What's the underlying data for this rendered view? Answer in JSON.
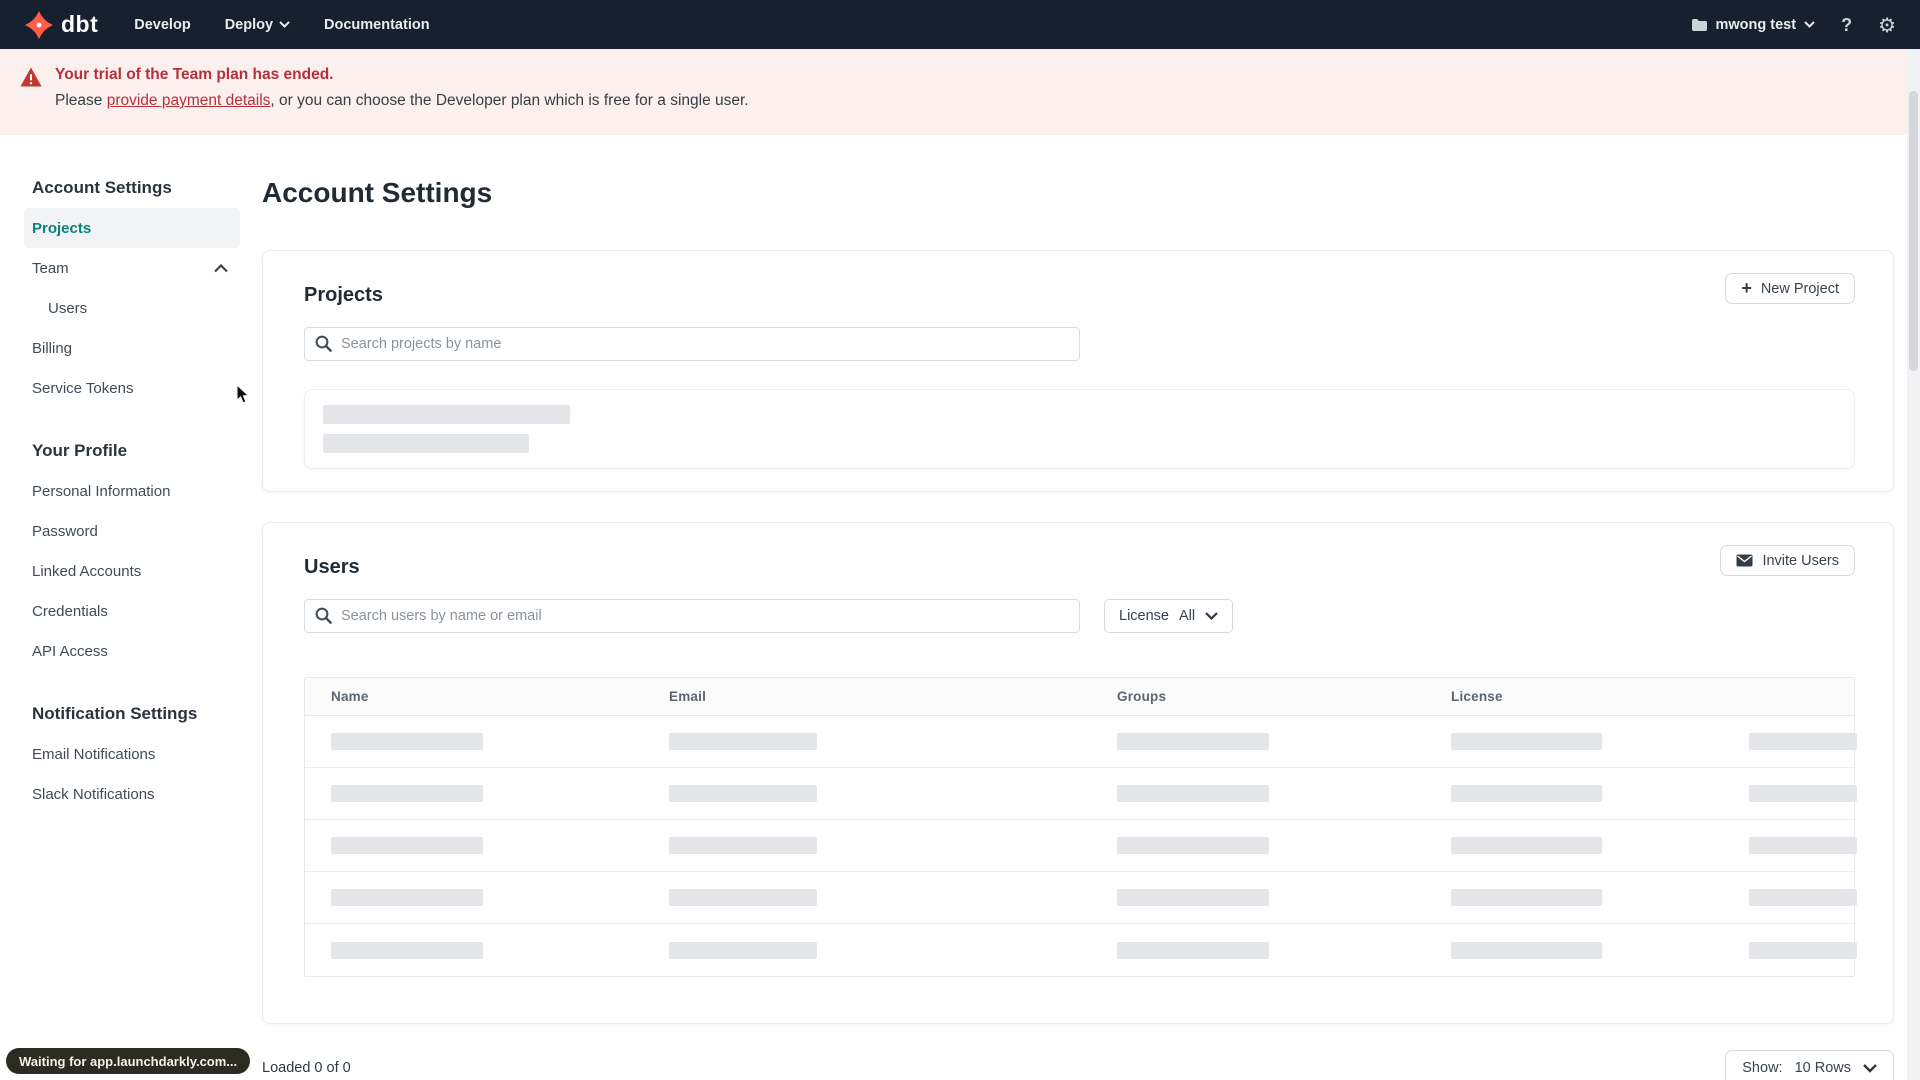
{
  "colors": {
    "nav_bg": "#17202E",
    "logo_orange": "#FF5C49",
    "accent_teal": "#0A837A",
    "banner_bg": "#FBF0ED",
    "banner_red": "#B5303A",
    "skeleton_gray": "#E4E6E9"
  },
  "nav": {
    "logo_text": "dbt",
    "menu": [
      {
        "label": "Develop"
      },
      {
        "label": "Deploy"
      },
      {
        "label": "Documentation"
      }
    ],
    "account_label": "mwong test",
    "help_glyph": "?",
    "gear_glyph": "⚙"
  },
  "banner": {
    "title": "Your trial of the Team plan has ended.",
    "body_prefix": "Please ",
    "link_text": "provide payment details",
    "body_suffix": ", or you can choose the Developer plan which is free for a single user."
  },
  "sidebar": {
    "sections": [
      {
        "heading": "Account Settings",
        "items": [
          {
            "label": "Projects"
          },
          {
            "label": "Team"
          },
          {
            "label": "Users"
          },
          {
            "label": "Billing"
          },
          {
            "label": "Service Tokens"
          }
        ]
      },
      {
        "heading": "Your Profile",
        "items": [
          {
            "label": "Personal Information"
          },
          {
            "label": "Password"
          },
          {
            "label": "Linked Accounts"
          },
          {
            "label": "Credentials"
          },
          {
            "label": "API Access"
          }
        ]
      },
      {
        "heading": "Notification Settings",
        "items": [
          {
            "label": "Email Notifications"
          },
          {
            "label": "Slack Notifications"
          }
        ]
      }
    ]
  },
  "main": {
    "title": "Account Settings",
    "projects": {
      "heading": "Projects",
      "new_button": "New Project",
      "search_placeholder": "Search projects by name"
    },
    "users": {
      "heading": "Users",
      "invite_button": "Invite Users",
      "search_placeholder": "Search users by name or email",
      "license_filter_label": "License",
      "license_filter_value": "All",
      "table": {
        "columns": [
          "Name",
          "Email",
          "Groups",
          "License"
        ],
        "skeleton_rows": 5
      },
      "footer": {
        "loaded_text": "Loaded 0 of 0",
        "show_label": "Show:",
        "show_value": "10 Rows"
      }
    }
  },
  "status_bar": {
    "text": "Waiting for app.launchdarkly.com..."
  }
}
